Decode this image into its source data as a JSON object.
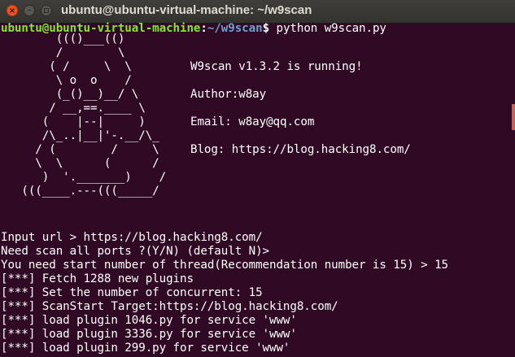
{
  "window": {
    "title": "ubuntu@ubuntu-virtual-machine: ~/w9scan"
  },
  "icons": {
    "close": "close-icon",
    "minimize": "minimize-icon",
    "maximize": "maximize-icon"
  },
  "prompt": {
    "user_host": "ubuntu@ubuntu-virtual-machine",
    "colon": ":",
    "path": "~/w9scan",
    "dollar": "$",
    "command": " python w9scan.py"
  },
  "banner": [
    {
      "art": "        ((()___(()  ",
      "info": ""
    },
    {
      "art": "        /        \\  ",
      "info": ""
    },
    {
      "art": "       ( /     \\  \\       ",
      "info": "W9scan v1.3.2 is running!"
    },
    {
      "art": "        \\ o  o    /  ",
      "info": ""
    },
    {
      "art": "        (_()__)__/ \\      ",
      "info": "Author:w8ay"
    },
    {
      "art": "       / __,==.____ \\  ",
      "info": ""
    },
    {
      "art": "      (    |--|     )     ",
      "info": "Email: w8ay@qq.com"
    },
    {
      "art": "      /\\_..|__|'-.__/\\_  ",
      "info": ""
    },
    {
      "art": "     / (        /     \\   ",
      "info": "Blog: https://blog.hacking8.com/"
    },
    {
      "art": "     \\  \\      (      /  ",
      "info": ""
    },
    {
      "art": "      )  '._______)    /  ",
      "info": ""
    },
    {
      "art": "   (((____.---(((_____/  ",
      "info": ""
    }
  ],
  "output": [
    "Input url > https://blog.hacking8.com/",
    "Need scan all ports ?(Y/N) (default N)>",
    "You need start number of thread(Recommendation number is 15) > 15",
    "[***] Fetch 1288 new plugins",
    "[***] Set the number of concurrent: 15",
    "[***] ScanStart Target:https://blog.hacking8.com/",
    "[***] load plugin 1046.py for service 'www'",
    "[***] load plugin 3336.py for service 'www'",
    "[***] load plugin 299.py for service 'www'"
  ],
  "colors": {
    "background": "#300a24",
    "prompt_user": "#8ae234",
    "prompt_path": "#729fcf",
    "text": "#ffffff",
    "close_button": "#e95420"
  }
}
